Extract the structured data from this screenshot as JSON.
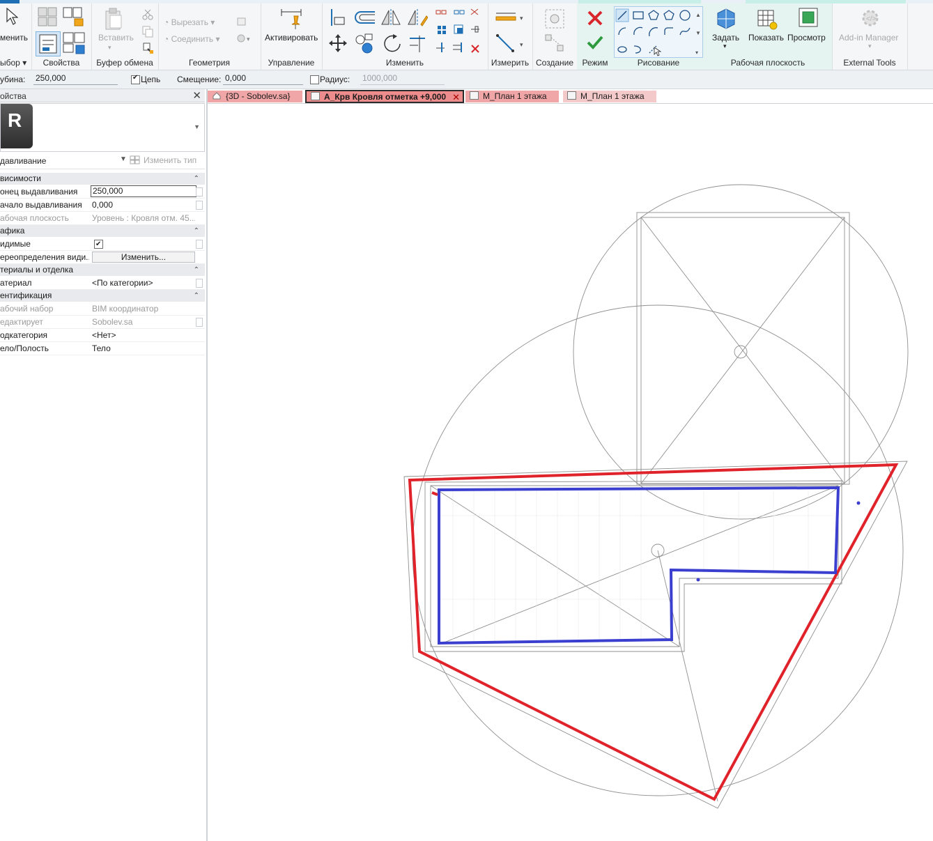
{
  "ribbon": {
    "panels": {
      "select": "ыбор",
      "properties": "Свойства",
      "clipboard": "Буфер обмена",
      "geometry": "Геометрия",
      "control": "Управление",
      "modify": "Изменить",
      "measure": "Измерить",
      "create": "Создание",
      "mode": "Режим",
      "draw": "Рисование",
      "work_plane": "Рабочая плоскость",
      "external_tools": "External Tools"
    },
    "buttons": {
      "modify": "менить",
      "paste": "Вставить",
      "cut": "Вырезать",
      "join": "Соединить",
      "activate": "Активировать",
      "set": "Задать",
      "show": "Показать",
      "viewer": "Просмотр",
      "addin_manager": "Add-in Manager"
    },
    "colors": {
      "accent_blue": "#1e6fb3",
      "context_tab": "#c7efe8",
      "cancel_red": "#d9262c",
      "finish_green": "#2d9a3e"
    }
  },
  "options_bar": {
    "depth_label": "убина:",
    "depth_value": "250,000",
    "chain_label": "Цепь",
    "chain_checked": true,
    "offset_label": "Смещение:",
    "offset_value": "0,000",
    "radius_label": "Радиус:",
    "radius_checked": false,
    "radius_value": "1000,000"
  },
  "properties": {
    "title": "ойства",
    "type_selector": "давливание",
    "edit_type": "Изменить тип",
    "groups": [
      {
        "label": "висимости",
        "rows": [
          {
            "key": "онец выдавливания",
            "value": "250,000",
            "editing": true
          },
          {
            "key": "ачало выдавливания",
            "value": "0,000"
          },
          {
            "key": "абочая плоскость",
            "value": "Уровень : Кровля отм. 45...",
            "dim": true
          }
        ]
      },
      {
        "label": "афика",
        "rows": [
          {
            "key": "идимые",
            "value": "",
            "checkbox": true
          },
          {
            "key": "ереопределения види...",
            "value": "Изменить...",
            "button": true
          }
        ]
      },
      {
        "label": "териалы и отделка",
        "rows": [
          {
            "key": "атериал",
            "value": "<По категории>"
          }
        ]
      },
      {
        "label": "ентификация",
        "rows": [
          {
            "key": "абочий набор",
            "value": "BIM координатор",
            "dim": true
          },
          {
            "key": "едактирует",
            "value": "Sobolev.sa",
            "dim": true
          },
          {
            "key": "одкатегория",
            "value": "<Нет>"
          },
          {
            "key": "ело/Полость",
            "value": "Тело"
          }
        ]
      }
    ]
  },
  "view_tabs": [
    {
      "label": "{3D - Sobolev.sa}",
      "active": false,
      "color": "#f0a6a6"
    },
    {
      "label": "А_Крв Кровля отметка +9,000",
      "active": true,
      "color": "#ec8c8c"
    },
    {
      "label": "М_План 1 этажа",
      "active": false,
      "color": "#f0a6a6"
    },
    {
      "label": "М_План 1 этажа",
      "active": false,
      "color": "#f3c9c9"
    }
  ],
  "sketch": {
    "boundary_color": "#e0222a",
    "opening_color": "#3b3fcf",
    "reference_color": "#8f8f8f"
  }
}
